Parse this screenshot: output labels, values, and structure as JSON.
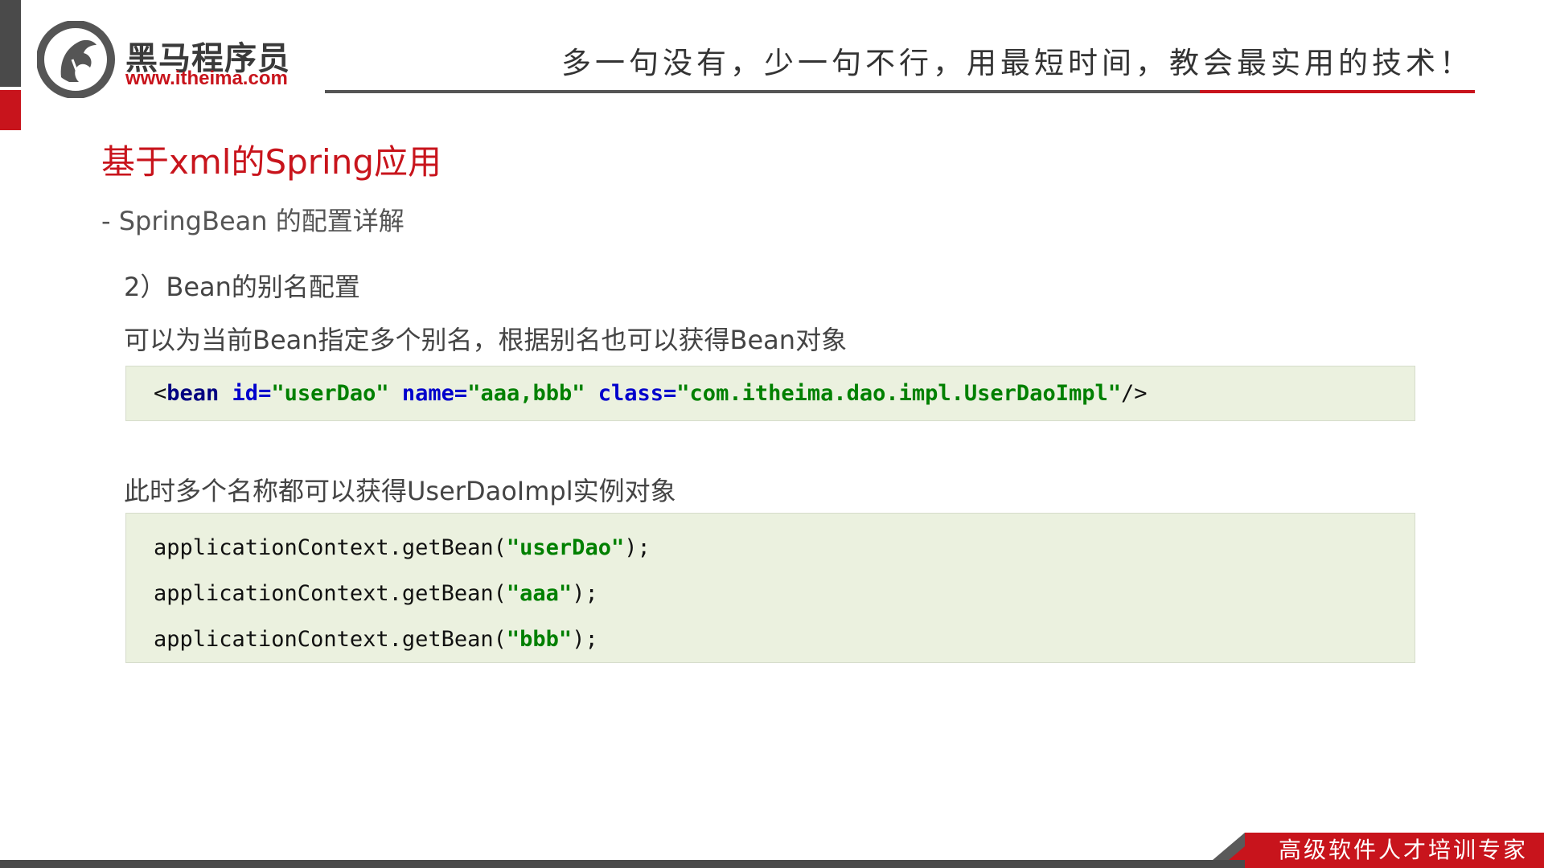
{
  "header": {
    "logo_name": "黑马程序员",
    "logo_url": "www.itheima.com",
    "slogan": "多一句没有，少一句不行，用最短时间，教会最实用的技术！"
  },
  "main": {
    "title": "基于xml的Spring应用",
    "subtitle": "- SpringBean 的配置详解",
    "section": "2）Bean的别名配置",
    "description": "可以为当前Bean指定多个别名，根据别名也可以获得Bean对象",
    "code1": {
      "open": "<",
      "tag": "bean",
      "attr1": " id=",
      "val1": "\"userDao\"",
      "attr2": " name=",
      "val2": "\"aaa,bbb\"",
      "attr3": " class=",
      "val3": "\"com.itheima.dao.impl.UserDaoImpl\"",
      "close": "/>"
    },
    "description2": "此时多个名称都可以获得UserDaoImpl实例对象",
    "code2": [
      {
        "prefix": "applicationContext.getBean(",
        "arg": "\"userDao\"",
        "suffix": ");"
      },
      {
        "prefix": "applicationContext.getBean(",
        "arg": "\"aaa\"",
        "suffix": ");"
      },
      {
        "prefix": "applicationContext.getBean(",
        "arg": "\"bbb\"",
        "suffix": ");"
      }
    ]
  },
  "footer": {
    "tagline": "高级软件人才培训专家"
  },
  "colors": {
    "brand_red": "#c8141c",
    "code_bg": "#ebf1df",
    "string_green": "#008000",
    "attr_blue": "#0000cc"
  }
}
